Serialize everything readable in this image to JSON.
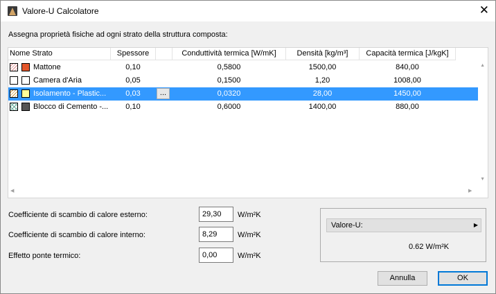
{
  "window": {
    "title": "Valore-U Calcolatore",
    "close_glyph": "✕"
  },
  "instruction": "Assegna proprietà fisiche ad ogni strato della struttura composta:",
  "table": {
    "headers": {
      "name": "Nome Strato",
      "thickness": "Spessore",
      "conductivity": "Conduttività termica [W/mK]",
      "density": "Densità [kg/m³]",
      "heat_capacity": "Capacità termica [J/kgK]"
    },
    "rows": [
      {
        "name": "Mattone",
        "thickness": "0,10",
        "conductivity": "0,5800",
        "density": "1500,00",
        "heat_capacity": "840,00",
        "fill_color": "#e3562b",
        "hatch": "diag"
      },
      {
        "name": "Camera d'Aria",
        "thickness": "0,05",
        "conductivity": "0,1500",
        "density": "1,20",
        "heat_capacity": "1008,00",
        "fill_color": "#ffffff",
        "hatch": "empty"
      },
      {
        "name": "Isolamento - Plastic...",
        "thickness": "0,03",
        "conductivity": "0,0320",
        "density": "28,00",
        "heat_capacity": "1450,00",
        "fill_color": "#ffff99",
        "hatch": "diag-y",
        "selected": true,
        "dots_label": "..."
      },
      {
        "name": "Blocco di Cemento -...",
        "thickness": "0,10",
        "conductivity": "0,6000",
        "density": "1400,00",
        "heat_capacity": "880,00",
        "fill_color": "#555555",
        "hatch": "cross"
      }
    ]
  },
  "coefficients": {
    "external_label": "Coefficiente di scambio di calore esterno:",
    "external_value": "29,30",
    "internal_label": "Coefficiente di scambio di calore interno:",
    "internal_value": "8,29",
    "bridge_label": "Effetto ponte termico:",
    "bridge_value": "0,00",
    "unit": "W/m²K"
  },
  "result": {
    "label": "Valore-U:",
    "value": "0.62  W/m²K"
  },
  "buttons": {
    "cancel": "Annulla",
    "ok": "OK"
  }
}
